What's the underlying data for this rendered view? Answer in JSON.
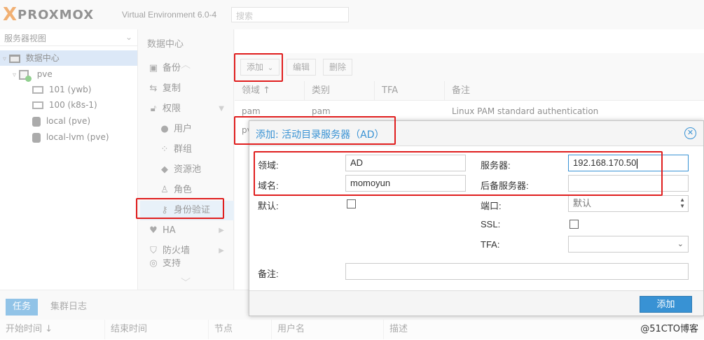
{
  "header": {
    "logo_x": "X",
    "logo_text": "PROXMOX",
    "version": "Virtual Environment 6.0-4",
    "search_placeholder": "搜索"
  },
  "tree": {
    "view_label": "服务器视图",
    "items": [
      {
        "label": "数据中心"
      },
      {
        "label": "pve"
      },
      {
        "label": "101 (ywb)"
      },
      {
        "label": "100 (k8s-1)"
      },
      {
        "label": "local (pve)"
      },
      {
        "label": "local-lvm (pve)"
      }
    ]
  },
  "dc_menu": {
    "title": "数据中心",
    "items": [
      {
        "label": "备份",
        "icon": "floppy-icon"
      },
      {
        "label": "复制",
        "icon": "retweet-icon"
      },
      {
        "label": "权限",
        "icon": "unlock-icon"
      },
      {
        "label": "用户",
        "icon": "user-icon"
      },
      {
        "label": "群组",
        "icon": "users-icon"
      },
      {
        "label": "资源池",
        "icon": "tags-icon"
      },
      {
        "label": "角色",
        "icon": "male-icon"
      },
      {
        "label": "身份验证",
        "icon": "key-icon"
      },
      {
        "label": "HA",
        "icon": "heartbeat-icon"
      },
      {
        "label": "防火墙",
        "icon": "shield-icon"
      },
      {
        "label": "支持",
        "icon": "support-icon"
      }
    ]
  },
  "content": {
    "toolbar": {
      "add": "添加",
      "edit": "编辑",
      "delete": "删除"
    },
    "columns": [
      "领域 ↑",
      "类别",
      "TFA",
      "备注"
    ],
    "rows": [
      {
        "realm": "pam",
        "type": "pam",
        "tfa": "",
        "comment": "Linux PAM standard authentication"
      },
      {
        "realm": "pve",
        "type": "",
        "tfa": "",
        "comment": ""
      }
    ]
  },
  "bottom": {
    "tabs": [
      "任务",
      "集群日志"
    ],
    "columns": [
      "开始时间 ↓",
      "结束时间",
      "节点",
      "用户名",
      "描述"
    ]
  },
  "dialog": {
    "title": "添加: 活动目录服务器（AD）",
    "labels": {
      "realm": "领域:",
      "domain": "域名:",
      "default": "默认:",
      "comment": "备注:",
      "server": "服务器:",
      "fallback": "后备服务器:",
      "port": "端口:",
      "ssl": "SSL:",
      "tfa": "TFA:"
    },
    "values": {
      "realm": "AD",
      "domain": "momoyun",
      "server": "192.168.170.50",
      "fallback": "",
      "port_placeholder": "默认",
      "tfa": "",
      "comment": ""
    },
    "add_button": "添加"
  },
  "watermark": "@51CTO博客",
  "colors": {
    "accent": "#3892d4",
    "annotation_red": "#e01e1e",
    "proxmox_orange": "#e57000"
  }
}
